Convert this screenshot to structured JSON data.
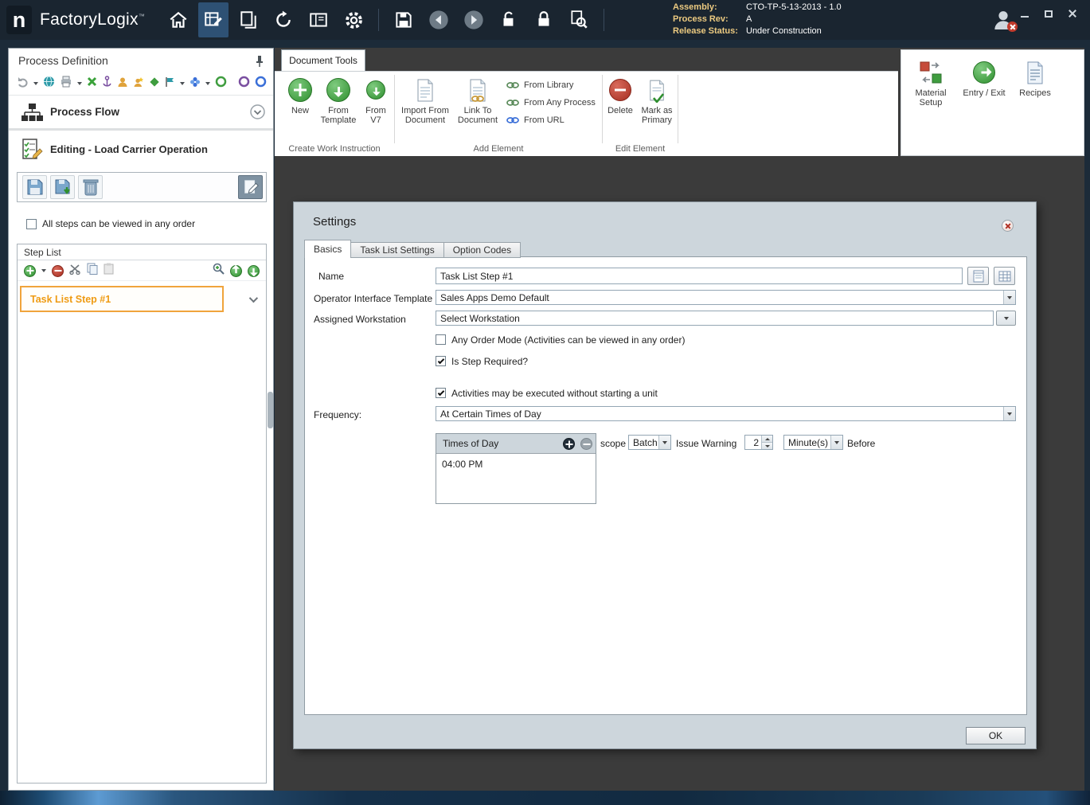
{
  "colors": {
    "titlebar_bg": "#1A2530",
    "canvas_bg": "#3B3B3B",
    "dialog_bg": "#CDD6DC",
    "accent_orange": "#EF9B13",
    "accent_green": "#3FA33F",
    "accent_red": "#B2382C",
    "active_tool_bg": "#2E5174"
  },
  "titlebar": {
    "logo": "n",
    "app_name": "FactoryLogix",
    "trademark": "™",
    "assembly_label": "Assembly:",
    "assembly_value": "CTO-TP-5-13-2013 - 1.0",
    "process_rev_label": "Process Rev:",
    "process_rev_value": "A",
    "release_status_label": "Release Status:",
    "release_status_value": "Under Construction"
  },
  "sidebar": {
    "title": "Process Definition",
    "process_flow_label": "Process Flow",
    "editing_label": "Editing - Load Carrier Operation",
    "any_order_label": "All steps can be viewed in any order",
    "step_list_title": "Step List",
    "steps": [
      {
        "label": "Task List Step #1"
      }
    ]
  },
  "ribbon": {
    "tab_label": "Document Tools",
    "groups": [
      {
        "label": "Create Work Instruction",
        "items": [
          {
            "label": "New"
          },
          {
            "label": "From Template"
          },
          {
            "label": "From V7"
          }
        ]
      },
      {
        "label": "Add Element",
        "items": [
          {
            "label": "Import From Document"
          },
          {
            "label": "Link To Document"
          }
        ],
        "small_items": [
          {
            "label": "From Library"
          },
          {
            "label": "From Any Process"
          },
          {
            "label": "From URL"
          }
        ]
      },
      {
        "label": "Edit Element",
        "items": [
          {
            "label": "Delete"
          },
          {
            "label": "Mark as Primary"
          }
        ]
      }
    ],
    "right_items": [
      {
        "label": "Material Setup"
      },
      {
        "label": "Entry / Exit"
      },
      {
        "label": "Recipes"
      }
    ]
  },
  "dialog": {
    "title": "Settings",
    "tabs": [
      {
        "label": "Basics"
      },
      {
        "label": "Task List Settings"
      },
      {
        "label": "Option Codes"
      }
    ],
    "name_label": "Name",
    "name_value": "Task List Step #1",
    "template_label": "Operator Interface Template",
    "template_value": "Sales Apps Demo Default",
    "workstation_label": "Assigned Workstation",
    "workstation_value": "Select Workstation",
    "any_order_checkbox": {
      "label": "Any Order Mode (Activities can be viewed in any order)",
      "checked": false
    },
    "step_required_checkbox": {
      "label": "Is Step Required?",
      "checked": true
    },
    "activities_checkbox": {
      "label": "Activities may be executed without starting a unit",
      "checked": true
    },
    "frequency_label": "Frequency:",
    "frequency_value": "At Certain Times of Day",
    "times_panel": {
      "title": "Times of Day",
      "items": [
        "04:00 PM"
      ]
    },
    "scope_label": "scope",
    "scope_value": "Batch",
    "issue_warning_label": "Issue Warning",
    "issue_warning_value": "2",
    "issue_warning_unit": "Minute(s)",
    "before_label": "Before",
    "ok_label": "OK"
  }
}
